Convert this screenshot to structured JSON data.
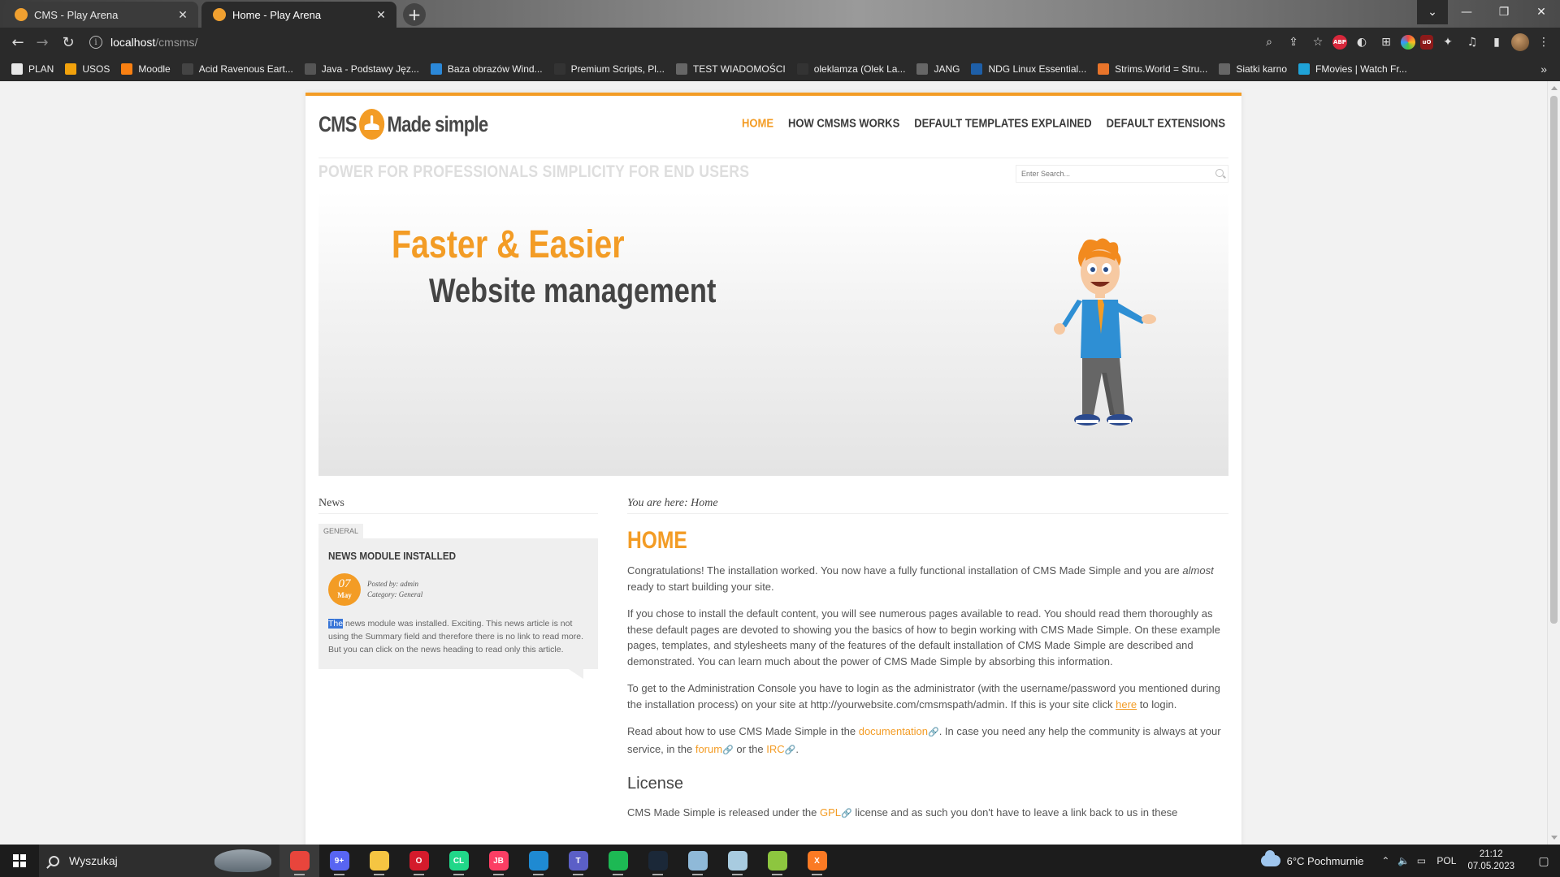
{
  "browser": {
    "tabs": [
      {
        "title": "CMS - Play Arena",
        "close": "✕"
      },
      {
        "title": "Home - Play Arena",
        "close": "✕"
      }
    ],
    "new_tab": "+",
    "url_host": "localhost",
    "url_path": "/cmsms/",
    "extension_labels": {
      "abp": "ABP",
      "ublock": "uO"
    },
    "bookmarks": [
      {
        "label": "PLAN",
        "icon": "plan-icon",
        "color": "#e8e8e8"
      },
      {
        "label": "USOS",
        "icon": "usos-icon",
        "color": "#f2a20c"
      },
      {
        "label": "Moodle",
        "icon": "moodle-icon",
        "color": "#f98012"
      },
      {
        "label": "Acid Ravenous Eart...",
        "icon": "page-icon",
        "color": "#444444"
      },
      {
        "label": "Java - Podstawy Jęz...",
        "icon": "page-icon",
        "color": "#555555"
      },
      {
        "label": "Baza obrazów Wind...",
        "icon": "windows-icon",
        "color": "#2b88d8"
      },
      {
        "label": "Premium Scripts, Pl...",
        "icon": "cl-icon",
        "color": "#333333"
      },
      {
        "label": "TEST WIADOMOŚCI",
        "icon": "globe-icon",
        "color": "#666666"
      },
      {
        "label": "oleklamza (Olek La...",
        "icon": "github-icon",
        "color": "#333333"
      },
      {
        "label": "JANG",
        "icon": "globe-icon",
        "color": "#666666"
      },
      {
        "label": "NDG Linux Essential...",
        "icon": "ndg-icon",
        "color": "#1e5fa8"
      },
      {
        "label": "Strims.World = Stru...",
        "icon": "strims-icon",
        "color": "#e8742a"
      },
      {
        "label": "Siatki karno",
        "icon": "globe-icon",
        "color": "#666666"
      },
      {
        "label": "FMovies | Watch Fr...",
        "icon": "fmovies-icon",
        "color": "#1fa3d8"
      }
    ],
    "bookmarks_more": "»"
  },
  "site": {
    "logo_left": "CMS",
    "logo_right": "Made simple",
    "nav": [
      {
        "label": "HOME",
        "current": true
      },
      {
        "label": "HOW CMSMS WORKS",
        "current": false
      },
      {
        "label": "DEFAULT TEMPLATES EXPLAINED",
        "current": false
      },
      {
        "label": "DEFAULT EXTENSIONS",
        "current": false
      }
    ],
    "slogan": "POWER FOR PROFESSIONALS SIMPLICITY FOR END USERS",
    "search_placeholder": "Enter Search...",
    "banner": {
      "title": "Faster & Easier",
      "subtitle": "Website management"
    },
    "accent_color": "#f39c25",
    "news": {
      "heading": "News",
      "tag": "GENERAL",
      "title": "NEWS MODULE INSTALLED",
      "day": "07",
      "month": "May",
      "posted_by": "Posted by: admin",
      "category": "Category: General",
      "body_selected": "The",
      "body_rest": " news module was installed. Exciting. This news article is not using the Summary field and therefore there is no link to read more. But you can click on the news heading to read only this article."
    },
    "content": {
      "breadcrumb": "You are here: Home",
      "title": "HOME",
      "p1_a": "Congratulations! The installation worked. You now have a fully functional installation of CMS Made Simple and you are ",
      "p1_em": "almost",
      "p1_b": " ready to start building your site.",
      "p2": "If you chose to install the default content, you will see numerous pages available to read. You should read them thoroughly as these default pages are devoted to showing you the basics of how to begin working with CMS Made Simple. On these example pages, templates, and stylesheets many of the features of the default installation of CMS Made Simple are described and demonstrated. You can learn much about the power of CMS Made Simple by absorbing this information.",
      "p3_a": "To get to the Administration Console you have to login as the administrator (with the username/password you mentioned during the installation process) on your site at http://yourwebsite.com/cmsmspath/admin. If this is your site click ",
      "p3_link": "here",
      "p3_b": " to login.",
      "p4_a": "Read about how to use CMS Made Simple in the ",
      "p4_link1": "documentation",
      "p4_b": ". In case you need any help the community is always at your service, in the ",
      "p4_link2": "forum",
      "p4_c": " or the ",
      "p4_link3": "IRC",
      "p4_d": ".",
      "license_heading": "License",
      "p5_a": "CMS Made Simple is released under the ",
      "p5_link": "GPL",
      "p5_b": " license and as such you don't have to leave a link back to us in these"
    }
  },
  "taskbar": {
    "search_label": "Wyszukaj",
    "apps": [
      {
        "name": "chrome-app",
        "color": "#e8453c",
        "glyph": "",
        "active": true
      },
      {
        "name": "discord-app",
        "color": "#5865f2",
        "glyph": "9+",
        "active": false
      },
      {
        "name": "file-explorer-app",
        "color": "#f5c542",
        "glyph": "",
        "active": false
      },
      {
        "name": "opera-app",
        "color": "#d41b2c",
        "glyph": "O",
        "active": false
      },
      {
        "name": "clion-app",
        "color": "#21d789",
        "glyph": "CL",
        "active": false
      },
      {
        "name": "jetbrains-app",
        "color": "#fc3e64",
        "glyph": "JB",
        "active": false
      },
      {
        "name": "vscode-app",
        "color": "#1f8ad2",
        "glyph": "",
        "active": false
      },
      {
        "name": "teams-app",
        "color": "#5b5fc7",
        "glyph": "T",
        "active": false
      },
      {
        "name": "spotify-app",
        "color": "#1db954",
        "glyph": "",
        "active": false
      },
      {
        "name": "steam-app",
        "color": "#1b2838",
        "glyph": "",
        "active": false
      },
      {
        "name": "notepad-app",
        "color": "#8fb9d8",
        "glyph": "",
        "active": false
      },
      {
        "name": "notepad2-app",
        "color": "#a8cbe0",
        "glyph": "",
        "active": false
      },
      {
        "name": "notepadpp-app",
        "color": "#8dc63f",
        "glyph": "",
        "active": false
      },
      {
        "name": "xampp-app",
        "color": "#fb7a24",
        "glyph": "X",
        "active": false
      }
    ],
    "weather": "6°C  Pochmurnie",
    "language": "POL",
    "time": "21:12",
    "date": "07.05.2023"
  }
}
